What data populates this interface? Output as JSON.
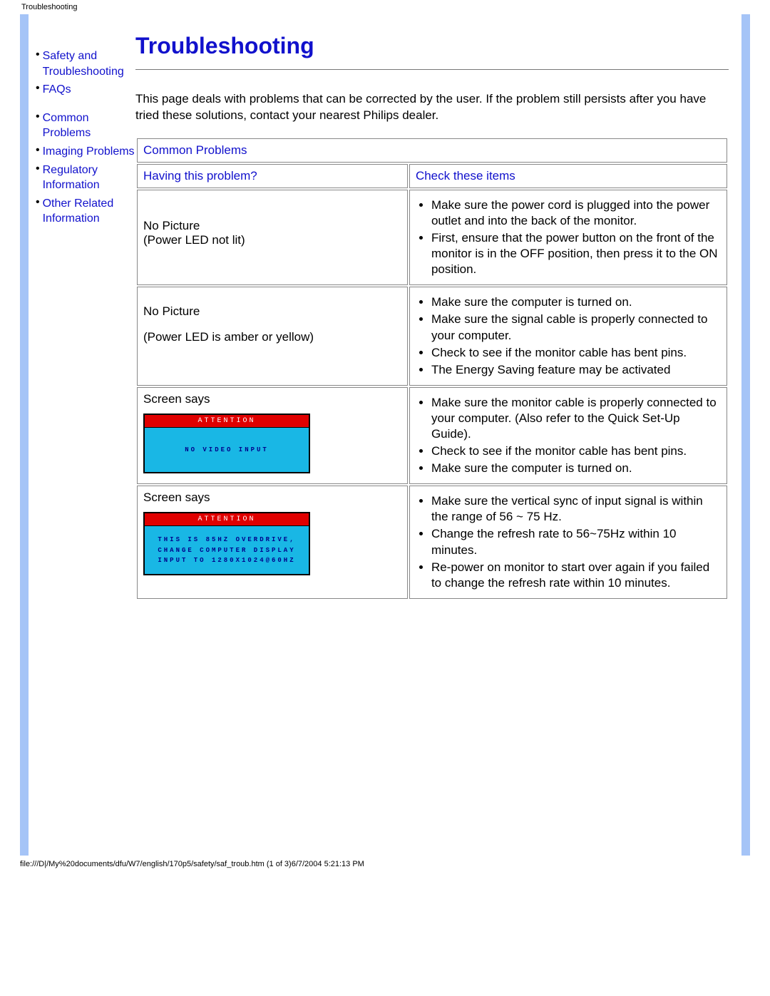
{
  "header_text": "Troubleshooting",
  "sidebar": {
    "items": [
      {
        "label": "Safety and Troubleshooting"
      },
      {
        "label": "FAQs"
      },
      {
        "label": "Common Problems"
      },
      {
        "label": "Imaging Problems"
      },
      {
        "label": "Regulatory Information"
      },
      {
        "label": "Other Related Information"
      }
    ]
  },
  "main": {
    "title": "Troubleshooting",
    "intro": "This page deals with problems that can be corrected by the user. If the problem still persists after you have tried these solutions, contact your nearest Philips dealer.",
    "section_header": "Common Problems",
    "col1_header": "Having this problem?",
    "col2_header": "Check these items",
    "rows": [
      {
        "problem_line1": "No Picture",
        "problem_line2": "(Power LED not lit)",
        "checks": [
          "Make sure the power cord is plugged into the power outlet and into the back of the monitor.",
          "First, ensure that the power button on the front of the monitor is in the OFF position, then press it to the ON position."
        ]
      },
      {
        "problem_line1": "No Picture",
        "problem_line2": "(Power LED is amber or yellow)",
        "checks": [
          "Make sure the computer is turned on.",
          "Make sure the signal cable is properly connected to your computer.",
          "Check to see if the monitor cable has bent pins.",
          "The Energy Saving feature may be activated"
        ]
      },
      {
        "problem_line1": "Screen says",
        "screen_attn": "ATTENTION",
        "screen_msg": "NO VIDEO INPUT",
        "checks": [
          "Make sure the monitor cable is properly connected to your computer. (Also refer to the Quick Set-Up Guide).",
          "Check to see if the monitor cable has bent pins.",
          "Make sure the computer is turned on."
        ]
      },
      {
        "problem_line1": "Screen says",
        "screen_attn": "ATTENTION",
        "screen_msg_l1": "THIS IS 85HZ OVERDRIVE,",
        "screen_msg_l2": "CHANGE COMPUTER DISPLAY",
        "screen_msg_l3": "INPUT TO 1280X1024@60HZ",
        "checks": [
          "Make sure the vertical sync of input signal is within the range of 56 ~ 75 Hz.",
          "Change the refresh rate to 56~75Hz within 10 minutes.",
          "Re-power on monitor to start over again if you failed to change the refresh rate within 10 minutes."
        ]
      }
    ]
  },
  "footer": "file:///D|/My%20documents/dfu/W7/english/170p5/safety/saf_troub.htm (1 of 3)6/7/2004 5:21:13 PM"
}
